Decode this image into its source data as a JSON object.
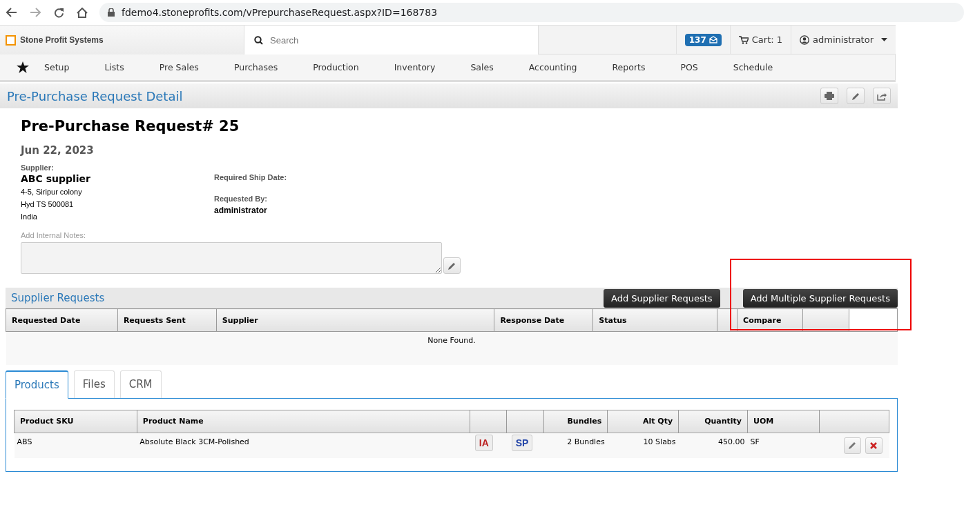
{
  "browser": {
    "url": "fdemo4.stoneprofits.com/vPrepurchaseRequest.aspx?ID=168783"
  },
  "header": {
    "brand": "Stone Profit Systems",
    "search": {
      "placeholder": "Search"
    },
    "messages": "137",
    "cart": "Cart: 1",
    "user": "administrator"
  },
  "nav": [
    "Setup",
    "Lists",
    "Pre Sales",
    "Purchases",
    "Production",
    "Inventory",
    "Sales",
    "Accounting",
    "Reports",
    "POS",
    "Schedule"
  ],
  "page_title": "Pre-Purchase Request Detail",
  "request": {
    "title": "Pre-Purchase Request# 25",
    "date": "Jun 22, 2023",
    "supplier_label": "Supplier:",
    "supplier": "ABC supplier",
    "address": [
      "4-5, Siripur colony",
      "Hyd TS 500081",
      "India"
    ],
    "ship_date_label": "Required Ship Date:",
    "requested_by_label": "Requested By:",
    "requested_by": "administrator",
    "notes_label": "Add Internal Notes:"
  },
  "supplier_requests": {
    "title": "Supplier Requests",
    "buttons": [
      "Add Supplier Requests",
      "Add Multiple Supplier Requests"
    ],
    "columns": [
      {
        "label": "Requested Date"
      },
      {
        "label": "Requests Sent"
      },
      {
        "label": "Supplier"
      },
      {
        "label": "Response Date"
      },
      {
        "label": "Status"
      },
      {},
      {
        "label": "Compare"
      },
      {},
      {}
    ],
    "empty_text": "None Found."
  },
  "tabs": [
    {
      "label": "Products",
      "selected": true
    },
    {
      "label": "Files",
      "selected": false
    },
    {
      "label": "CRM",
      "selected": false
    }
  ],
  "products": {
    "columns": [
      {
        "label": "Product SKU"
      },
      {
        "label": "Product Name"
      },
      {},
      {},
      {
        "label": "Bundles"
      },
      {
        "label": "Alt Qty"
      },
      {
        "label": "Quantity"
      },
      {
        "label": "UOM"
      },
      {}
    ],
    "rows": [
      {
        "sku": "ABS",
        "name": "Absolute Black 3CM-Polished",
        "ia": "IA",
        "sp": "SP",
        "bundles": "2 Bundles",
        "alt_qty": "10 Slabs",
        "quantity": "450.00",
        "uom": "SF"
      }
    ]
  }
}
